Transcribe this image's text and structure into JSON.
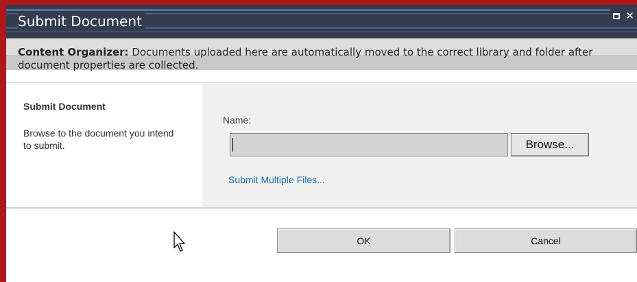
{
  "dialog": {
    "title": "Submit Document",
    "controls": {
      "maximize_icon": "maximize-icon",
      "close_icon": "close-icon",
      "close_glyph": "✕"
    }
  },
  "info": {
    "label": "Content Organizer:",
    "text": " Documents uploaded here are automatically moved to the correct library and folder after document properties are collected."
  },
  "section": {
    "title": "Submit Document",
    "description": "Browse to the document you intend to submit."
  },
  "form": {
    "name_label": "Name:",
    "file_value": "",
    "browse_label": "Browse...",
    "multi_link": "Submit Multiple Files..."
  },
  "buttons": {
    "ok_label": "OK",
    "cancel_label": "Cancel"
  },
  "colors": {
    "titlebar": "#333d4f",
    "frame": "#b01818",
    "link": "#1a6fb8"
  }
}
